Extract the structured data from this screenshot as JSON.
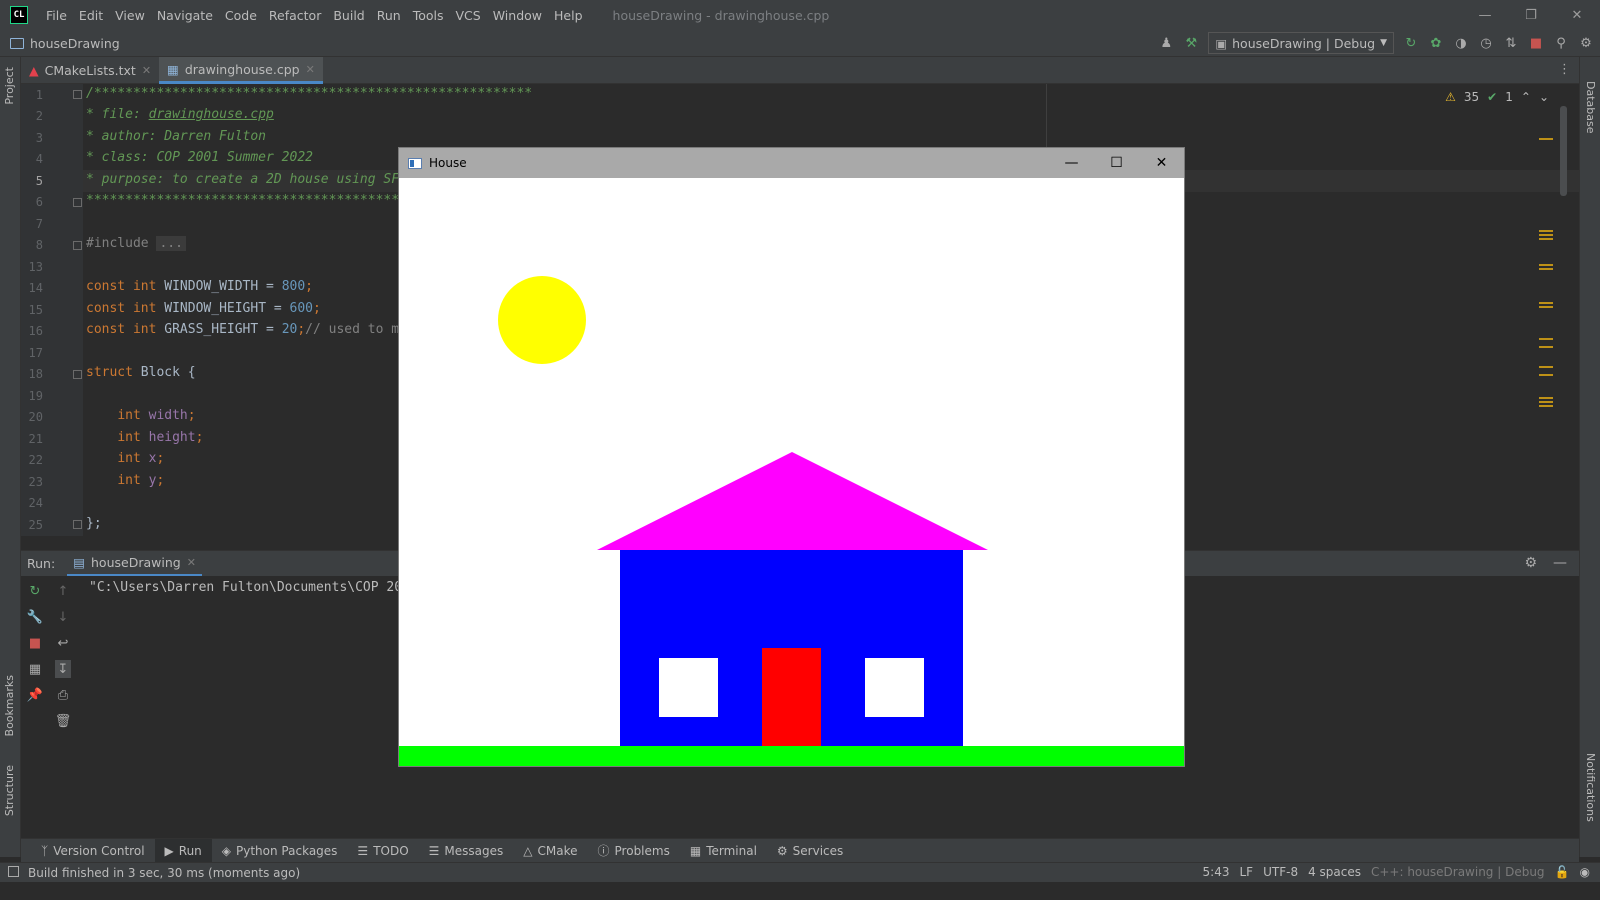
{
  "app": {
    "logo": "CL",
    "title": "houseDrawing - drawinghouse.cpp",
    "menu": [
      "File",
      "Edit",
      "View",
      "Navigate",
      "Code",
      "Refactor",
      "Build",
      "Run",
      "Tools",
      "VCS",
      "Window",
      "Help"
    ]
  },
  "navbar": {
    "project": "houseDrawing",
    "run_config": "houseDrawing | Debug"
  },
  "tabs": [
    {
      "label": "CMakeLists.txt",
      "icon": "cmake-icon"
    },
    {
      "label": "drawinghouse.cpp",
      "icon": "cpp-file-icon",
      "active": true
    }
  ],
  "inspections": {
    "warnings": "35",
    "ok": "1"
  },
  "editor": {
    "line_numbers": [
      "1",
      "2",
      "3",
      "4",
      "5",
      "6",
      "7",
      "8",
      "13",
      "14",
      "15",
      "16",
      "17",
      "18",
      "19",
      "20",
      "21",
      "22",
      "23",
      "24",
      "25"
    ],
    "current_line": "5",
    "lines": {
      "l1": "/********************************************************",
      "l2_prefix": "* file: ",
      "l2_file": "drawinghouse.cpp",
      "l3": "* author: Darren Fulton",
      "l4": "* class: COP 2001 Summer 2022",
      "l5": "* purpose: to create a 2D house using SF",
      "l6": "*****************************************",
      "l8_kw": "#include",
      "l8_fold": "...",
      "l14": {
        "kw": "const int",
        "name": " WINDOW_WIDTH = ",
        "num": "800",
        "end": ";"
      },
      "l15": {
        "kw": "const int",
        "name": " WINDOW_HEIGHT = ",
        "num": "600",
        "end": ";"
      },
      "l16": {
        "kw": "const int",
        "name": " GRASS_HEIGHT = ",
        "num": "20",
        "end": ";",
        "comment": "// used to m"
      },
      "l18": {
        "kw": "struct",
        "name": " Block {"
      },
      "l20": {
        "kw": "int",
        "field": " width",
        "end": ";"
      },
      "l21": {
        "kw": "int",
        "field": " height",
        "end": ";"
      },
      "l22": {
        "kw": "int",
        "field": " x",
        "end": ";"
      },
      "l23": {
        "kw": "int",
        "field": " y",
        "end": ";"
      },
      "l25": "};"
    }
  },
  "run_panel": {
    "label": "Run:",
    "tab": "houseDrawing",
    "console": "\"C:\\Users\\Darren Fulton\\Documents\\COP 20"
  },
  "bottom_tabs": [
    {
      "label": "Version Control",
      "icon": "branch-icon"
    },
    {
      "label": "Run",
      "icon": "play-icon",
      "active": true
    },
    {
      "label": "Python Packages",
      "icon": "packages-icon"
    },
    {
      "label": "TODO",
      "icon": "list-icon"
    },
    {
      "label": "Messages",
      "icon": "messages-icon"
    },
    {
      "label": "CMake",
      "icon": "cmake-icon"
    },
    {
      "label": "Problems",
      "icon": "problems-icon"
    },
    {
      "label": "Terminal",
      "icon": "terminal-icon"
    },
    {
      "label": "Services",
      "icon": "services-icon"
    }
  ],
  "status": {
    "message": "Build finished in 3 sec, 30 ms (moments ago)",
    "position": "5:43",
    "line_sep": "LF",
    "encoding": "UTF-8",
    "indent": "4 spaces",
    "context": "C++: houseDrawing | Debug"
  },
  "side_labels": {
    "left": [
      "Project",
      "Bookmarks",
      "Structure"
    ],
    "right": [
      "Database",
      "Notifications"
    ]
  },
  "house_window": {
    "title": "House",
    "colors": {
      "sky": "#ffffff",
      "sun": "#ffff00",
      "roof": "#ff00ff",
      "body": "#0000ff",
      "door": "#ff0000",
      "window": "#ffffff",
      "grass": "#00ff00"
    }
  }
}
